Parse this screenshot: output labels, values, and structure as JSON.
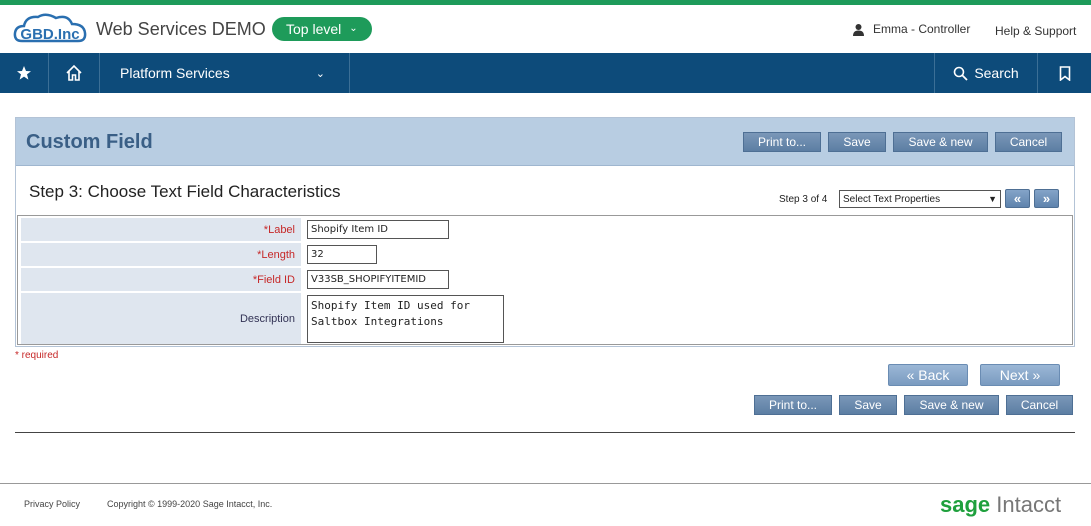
{
  "header": {
    "logo_text": "GBD.Inc",
    "company": "Web Services DEMO",
    "level": "Top level",
    "user": "Emma - Controller",
    "help": "Help & Support"
  },
  "nav": {
    "platform": "Platform Services",
    "search": "Search"
  },
  "panel": {
    "title": "Custom Field",
    "buttons": {
      "print": "Print to...",
      "save": "Save",
      "save_new": "Save & new",
      "cancel": "Cancel"
    },
    "step_title": "Step 3: Choose Text Field Characteristics",
    "step_info": "Step 3 of 4",
    "step_select": "Select Text Properties",
    "prev_arrow": "«",
    "next_arrow": "»"
  },
  "form": {
    "label": {
      "label": "*Label",
      "value": "Shopify Item ID"
    },
    "length": {
      "label": "*Length",
      "value": "32"
    },
    "field_id": {
      "label": "*Field ID",
      "value": "V33SB_SHOPIFYITEMID"
    },
    "description": {
      "label": "Description",
      "value": "Shopify Item ID used for\nSaltbox Integrations"
    }
  },
  "required_note": "* required",
  "wizard": {
    "back": "« Back",
    "next": "Next »"
  },
  "bottom_buttons": {
    "print": "Print to...",
    "save": "Save",
    "save_new": "Save & new",
    "cancel": "Cancel"
  },
  "footer": {
    "privacy": "Privacy Policy",
    "copyright": "Copyright © 1999-2020 Sage Intacct, Inc.",
    "brand_sage": "sage",
    "brand_intacct": " Intacct"
  },
  "colors": {
    "accent": "#1e9b5a",
    "nav_bg": "#0d4b7a",
    "panel_head": "#b8cde2",
    "required": "#c62828"
  }
}
